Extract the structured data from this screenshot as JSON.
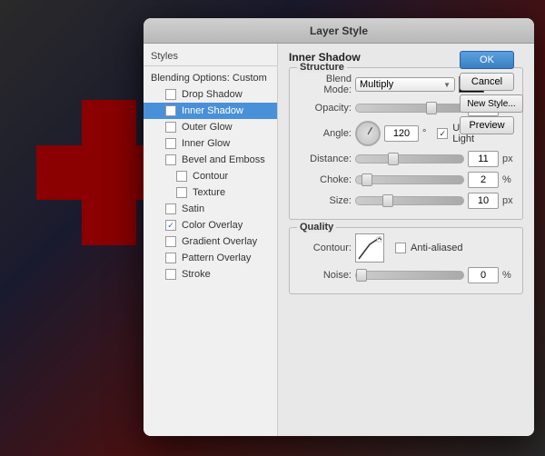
{
  "dialog": {
    "title": "Layer Style"
  },
  "left_panel": {
    "header": "Styles",
    "items": [
      {
        "id": "blending",
        "label": "Blending Options: Custom",
        "checkbox": false,
        "checked": false,
        "selected": false,
        "indented": false
      },
      {
        "id": "drop-shadow",
        "label": "Drop Shadow",
        "checkbox": true,
        "checked": false,
        "selected": false,
        "indented": false
      },
      {
        "id": "inner-shadow",
        "label": "Inner Shadow",
        "checkbox": true,
        "checked": false,
        "selected": true,
        "indented": false
      },
      {
        "id": "outer-glow",
        "label": "Outer Glow",
        "checkbox": true,
        "checked": false,
        "selected": false,
        "indented": false
      },
      {
        "id": "inner-glow",
        "label": "Inner Glow",
        "checkbox": true,
        "checked": false,
        "selected": false,
        "indented": false
      },
      {
        "id": "bevel-emboss",
        "label": "Bevel and Emboss",
        "checkbox": true,
        "checked": false,
        "selected": false,
        "indented": false
      },
      {
        "id": "contour",
        "label": "Contour",
        "checkbox": true,
        "checked": false,
        "selected": false,
        "indented": true
      },
      {
        "id": "texture",
        "label": "Texture",
        "checkbox": true,
        "checked": false,
        "selected": false,
        "indented": true
      },
      {
        "id": "satin",
        "label": "Satin",
        "checkbox": true,
        "checked": false,
        "selected": false,
        "indented": false
      },
      {
        "id": "color-overlay",
        "label": "Color Overlay",
        "checkbox": true,
        "checked": true,
        "selected": false,
        "indented": false
      },
      {
        "id": "gradient-overlay",
        "label": "Gradient Overlay",
        "checkbox": true,
        "checked": false,
        "selected": false,
        "indented": false
      },
      {
        "id": "pattern-overlay",
        "label": "Pattern Overlay",
        "checkbox": true,
        "checked": false,
        "selected": false,
        "indented": false
      },
      {
        "id": "stroke",
        "label": "Stroke",
        "checkbox": true,
        "checked": false,
        "selected": false,
        "indented": false
      }
    ]
  },
  "right_panel": {
    "section_title": "Inner Shadow",
    "structure_group": {
      "label": "Structure",
      "blend_mode_label": "Blend Mode:",
      "blend_mode_value": "Multiply",
      "blend_color": "#000000",
      "opacity_label": "Opacity:",
      "opacity_value": "70",
      "opacity_percent": "%",
      "opacity_slider_pos": "70",
      "angle_label": "Angle:",
      "angle_value": "120",
      "angle_degree": "°",
      "use_global_light_label": "Use Global Light",
      "distance_label": "Distance:",
      "distance_value": "11",
      "distance_unit": "px",
      "distance_slider_pos": "35",
      "choke_label": "Choke:",
      "choke_value": "2",
      "choke_unit": "%",
      "choke_slider_pos": "10",
      "size_label": "Size:",
      "size_value": "10",
      "size_unit": "px",
      "size_slider_pos": "30"
    },
    "quality_group": {
      "label": "Quality",
      "contour_label": "Contour:",
      "anti_aliased_label": "Anti-aliased",
      "noise_label": "Noise:",
      "noise_value": "0",
      "noise_percent": "%",
      "noise_slider_pos": "0"
    }
  },
  "buttons": {
    "ok": "OK",
    "cancel": "Cancel",
    "new_style": "New Style...",
    "preview": "Preview"
  },
  "icons": {
    "dropdown_arrow": "▼",
    "checked_mark": "✓"
  }
}
